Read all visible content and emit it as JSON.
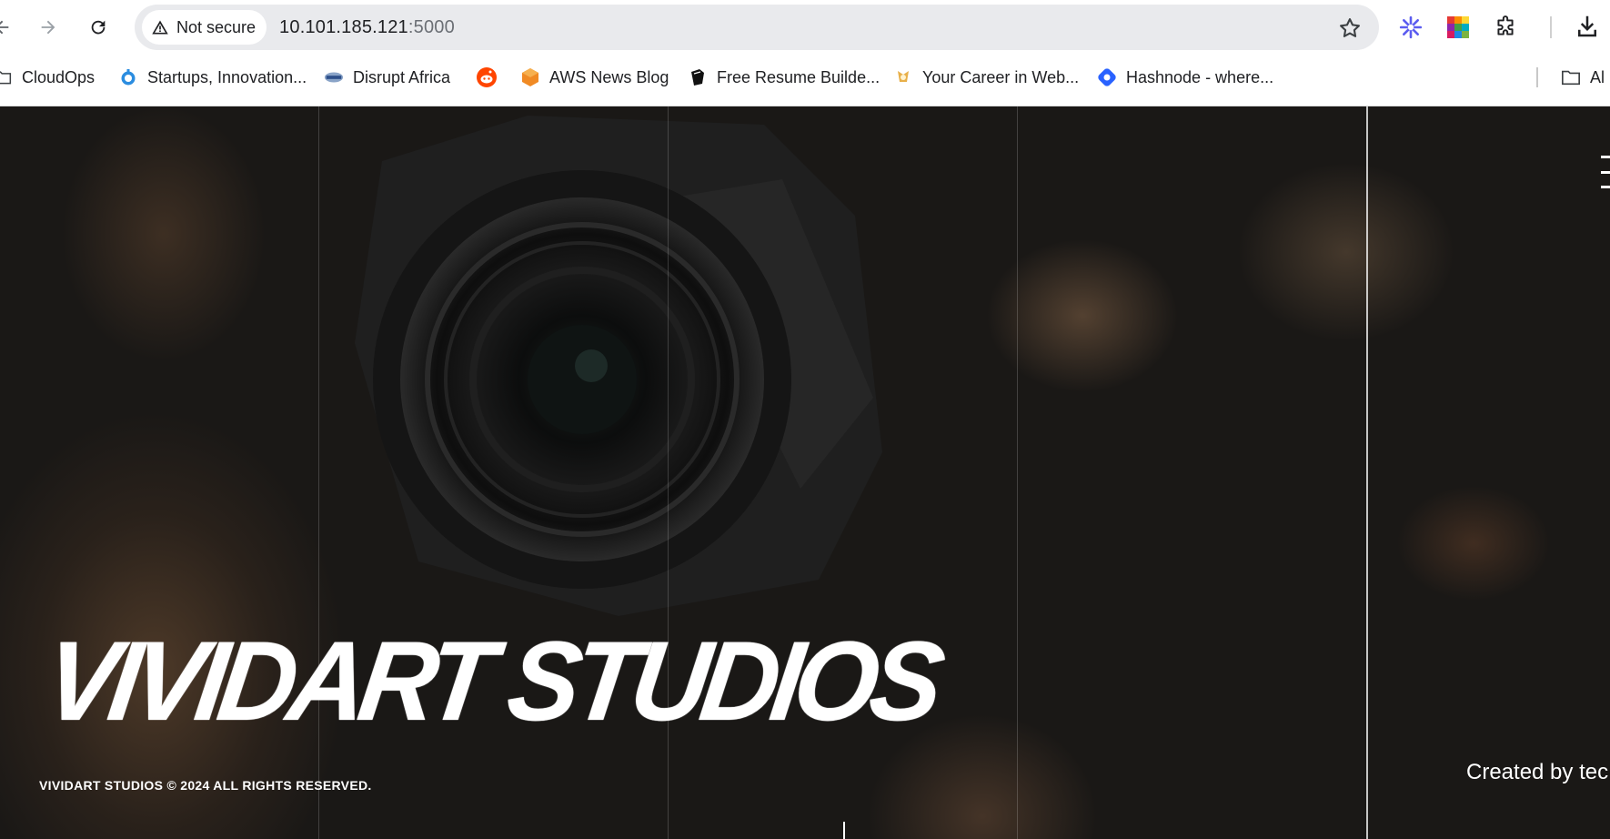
{
  "browser": {
    "security_label": "Not secure",
    "url_host": "10.101.185.121",
    "url_port": ":5000",
    "bookmarks": [
      {
        "label": "CloudOps",
        "icon": "folder-icon"
      },
      {
        "label": "Startups, Innovation...",
        "icon": "startups-favicon"
      },
      {
        "label": "Disrupt Africa",
        "icon": "disrupt-africa-favicon"
      },
      {
        "label": "",
        "icon": "reddit-favicon"
      },
      {
        "label": "AWS News Blog",
        "icon": "aws-favicon"
      },
      {
        "label": "Free Resume Builde...",
        "icon": "resume-favicon"
      },
      {
        "label": "Your Career in Web...",
        "icon": "career-favicon"
      },
      {
        "label": "Hashnode - where...",
        "icon": "hashnode-favicon"
      },
      {
        "label": "Al",
        "icon": "folder-icon"
      }
    ]
  },
  "page": {
    "hero_title": "VIVIDART STUDIOS",
    "copyright": "VIVIDART STUDIOS © 2024 ALL RIGHTS RESERVED.",
    "credit": "Created by tec"
  },
  "colors": {
    "accent_white": "#ffffff",
    "background_dark": "#1a1816"
  }
}
